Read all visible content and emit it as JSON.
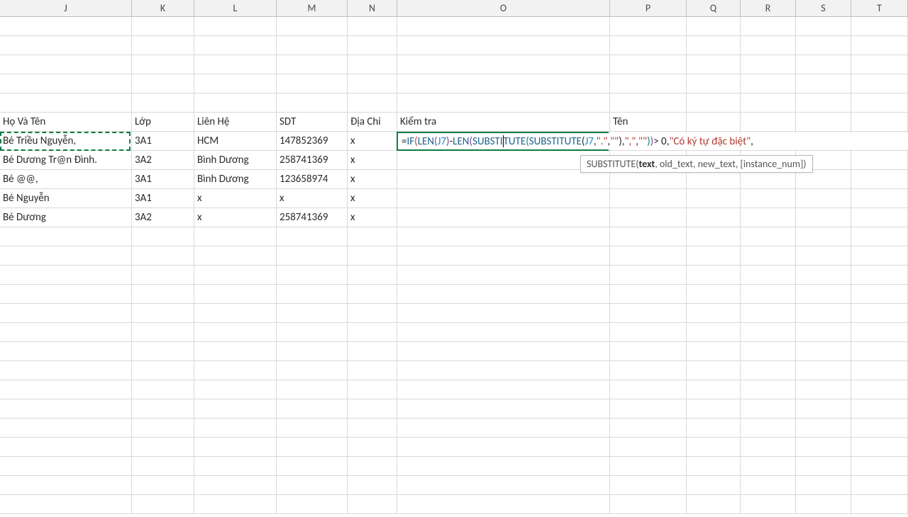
{
  "columns": [
    "J",
    "K",
    "L",
    "M",
    "N",
    "O",
    "P",
    "Q",
    "R",
    "S",
    "T"
  ],
  "headers": {
    "J": "Họ Và Tên",
    "K": "Lớp",
    "L": "Liên Hệ",
    "M": "SDT",
    "N": "Địa Chỉ",
    "O": "Kiểm tra",
    "P": "Tên"
  },
  "rows": [
    {
      "J": "Bé Triều Nguyễn,",
      "K": "3A1",
      "L": "HCM",
      "M": "147852369",
      "N": "x"
    },
    {
      "J": "Bé Dương Tr@n Đình.",
      "K": "3A2",
      "L": "Bình Dương",
      "M": "258741369",
      "N": "x"
    },
    {
      "J": "Bé @@,",
      "K": "3A1",
      "L": "Bình Dương",
      "M": "123658974",
      "N": "x"
    },
    {
      "J": "Bé Nguyễn",
      "K": "3A1",
      "L": "x",
      "M": "x",
      "N": "x"
    },
    {
      "J": "Bé Dương",
      "K": "3A2",
      "L": "x",
      "M": "258741369",
      "N": "x"
    }
  ],
  "formula": {
    "parts": {
      "eq": "=",
      "if": "IF",
      "len": "LEN",
      "sub": "SUBSTITUTE",
      "ref": "J7",
      "dot": "\".\"",
      "empty": "\"\"",
      "comma": "\",\"",
      "gt0": " > 0",
      "msg": "\"Có ký tự đặc biệt\""
    }
  },
  "tooltip": {
    "fn": "SUBSTITUTE",
    "sig_pre": "(",
    "arg_bold": "text",
    "sig_rest": ", old_text, new_text, [instance_num])"
  },
  "active_cell": "O7",
  "selected_ref_cell": "J7"
}
